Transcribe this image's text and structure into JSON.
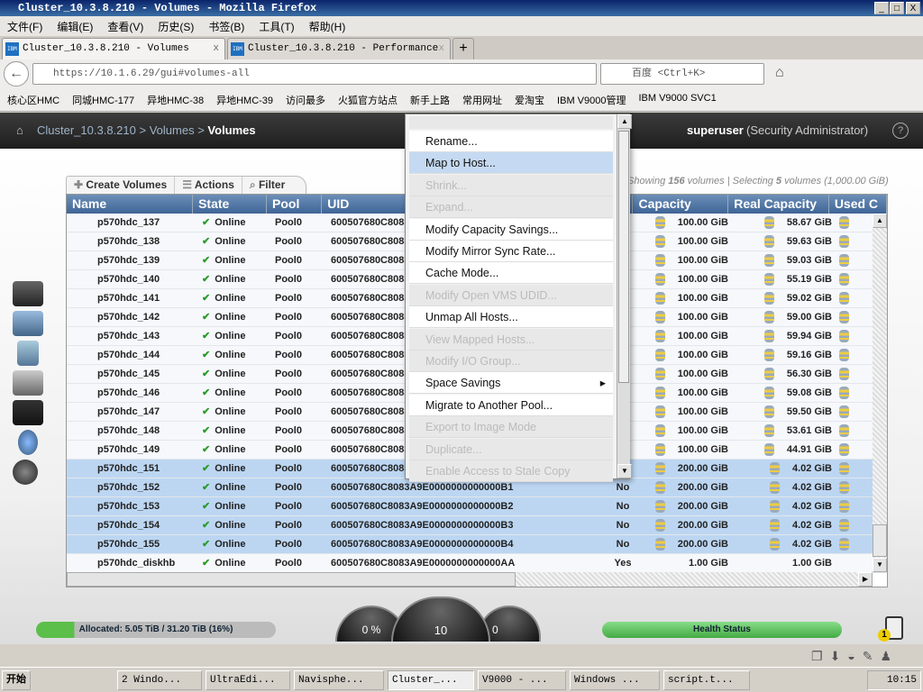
{
  "window": {
    "title": "Cluster_10.3.8.210 - Volumes - Mozilla Firefox",
    "min": "_",
    "max": "□",
    "close": "X"
  },
  "menubar": [
    "文件(F)",
    "编辑(E)",
    "查看(V)",
    "历史(S)",
    "书签(B)",
    "工具(T)",
    "帮助(H)"
  ],
  "tabs": [
    {
      "label": "Cluster_10.3.8.210 - Volumes",
      "close": "x"
    },
    {
      "label": "Cluster_10.3.8.210 - Performance",
      "close": "x"
    }
  ],
  "new_tab": "+",
  "url": "https://10.1.6.29/gui#volumes-all",
  "search_placeholder": "百度 <Ctrl+K>",
  "bookmarks": [
    "核心区HMC",
    "同城HMC-177",
    "异地HMC-38",
    "异地HMC-39",
    "访问最多",
    "火狐官方站点",
    "新手上路",
    "常用网址",
    "爱淘宝",
    "IBM V9000管理",
    "IBM V9000 SVC1"
  ],
  "app": {
    "breadcrumb": [
      "Cluster_10.3.8.210",
      "Volumes",
      "Volumes"
    ],
    "sep": ">",
    "user": "superuser",
    "role": "(Security Administrator)",
    "help": "?"
  },
  "toolbar": {
    "create": "Create Volumes",
    "actions": "Actions",
    "filter": "Filter"
  },
  "summary": {
    "prefix": "Showing ",
    "count": "156",
    "mid": " volumes | Selecting ",
    "sel": "5",
    "suffix": " volumes (1,000.00 GiB)"
  },
  "columns": [
    "Name",
    "State",
    "Pool",
    "UID",
    "",
    "Capacity",
    "Real Capacity",
    "Used C"
  ],
  "rows": [
    {
      "name": "p570hdc_137",
      "state": "Online",
      "pool": "Pool0",
      "uid": "600507680C8083",
      "flag": "",
      "cap": "100.00 GiB",
      "real": "58.67 GiB",
      "sel": false
    },
    {
      "name": "p570hdc_138",
      "state": "Online",
      "pool": "Pool0",
      "uid": "600507680C8083",
      "flag": "",
      "cap": "100.00 GiB",
      "real": "59.63 GiB",
      "sel": false
    },
    {
      "name": "p570hdc_139",
      "state": "Online",
      "pool": "Pool0",
      "uid": "600507680C8083",
      "flag": "",
      "cap": "100.00 GiB",
      "real": "59.03 GiB",
      "sel": false
    },
    {
      "name": "p570hdc_140",
      "state": "Online",
      "pool": "Pool0",
      "uid": "600507680C8083",
      "flag": "",
      "cap": "100.00 GiB",
      "real": "55.19 GiB",
      "sel": false
    },
    {
      "name": "p570hdc_141",
      "state": "Online",
      "pool": "Pool0",
      "uid": "600507680C8083",
      "flag": "",
      "cap": "100.00 GiB",
      "real": "59.02 GiB",
      "sel": false
    },
    {
      "name": "p570hdc_142",
      "state": "Online",
      "pool": "Pool0",
      "uid": "600507680C8083",
      "flag": "",
      "cap": "100.00 GiB",
      "real": "59.00 GiB",
      "sel": false
    },
    {
      "name": "p570hdc_143",
      "state": "Online",
      "pool": "Pool0",
      "uid": "600507680C8083",
      "flag": "",
      "cap": "100.00 GiB",
      "real": "59.94 GiB",
      "sel": false
    },
    {
      "name": "p570hdc_144",
      "state": "Online",
      "pool": "Pool0",
      "uid": "600507680C8083",
      "flag": "",
      "cap": "100.00 GiB",
      "real": "59.16 GiB",
      "sel": false
    },
    {
      "name": "p570hdc_145",
      "state": "Online",
      "pool": "Pool0",
      "uid": "600507680C8083",
      "flag": "",
      "cap": "100.00 GiB",
      "real": "56.30 GiB",
      "sel": false
    },
    {
      "name": "p570hdc_146",
      "state": "Online",
      "pool": "Pool0",
      "uid": "600507680C8083",
      "flag": "",
      "cap": "100.00 GiB",
      "real": "59.08 GiB",
      "sel": false
    },
    {
      "name": "p570hdc_147",
      "state": "Online",
      "pool": "Pool0",
      "uid": "600507680C8083",
      "flag": "",
      "cap": "100.00 GiB",
      "real": "59.50 GiB",
      "sel": false
    },
    {
      "name": "p570hdc_148",
      "state": "Online",
      "pool": "Pool0",
      "uid": "600507680C8083",
      "flag": "",
      "cap": "100.00 GiB",
      "real": "53.61 GiB",
      "sel": false
    },
    {
      "name": "p570hdc_149",
      "state": "Online",
      "pool": "Pool0",
      "uid": "600507680C8083",
      "flag": "",
      "cap": "100.00 GiB",
      "real": "44.91 GiB",
      "sel": false
    },
    {
      "name": "p570hdc_151",
      "state": "Online",
      "pool": "Pool0",
      "uid": "600507680C8083",
      "flag": "",
      "cap": "200.00 GiB",
      "real": "4.02 GiB",
      "sel": true
    },
    {
      "name": "p570hdc_152",
      "state": "Online",
      "pool": "Pool0",
      "uid": "600507680C8083A9E0000000000000B1",
      "flag": "No",
      "cap": "200.00 GiB",
      "real": "4.02 GiB",
      "sel": true
    },
    {
      "name": "p570hdc_153",
      "state": "Online",
      "pool": "Pool0",
      "uid": "600507680C8083A9E0000000000000B2",
      "flag": "No",
      "cap": "200.00 GiB",
      "real": "4.02 GiB",
      "sel": true
    },
    {
      "name": "p570hdc_154",
      "state": "Online",
      "pool": "Pool0",
      "uid": "600507680C8083A9E0000000000000B3",
      "flag": "No",
      "cap": "200.00 GiB",
      "real": "4.02 GiB",
      "sel": true
    },
    {
      "name": "p570hdc_155",
      "state": "Online",
      "pool": "Pool0",
      "uid": "600507680C8083A9E0000000000000B4",
      "flag": "No",
      "cap": "200.00 GiB",
      "real": "4.02 GiB",
      "sel": true
    },
    {
      "name": "p570hdc_diskhb",
      "state": "Online",
      "pool": "Pool0",
      "uid": "600507680C8083A9E0000000000000AA",
      "flag": "Yes",
      "cap": "1.00 GiB",
      "real": "1.00 GiB",
      "sel": false,
      "nodisk": true
    }
  ],
  "context_menu": [
    {
      "label": "Rename...",
      "disabled": false
    },
    {
      "label": "Map to Host...",
      "disabled": false,
      "hover": true
    },
    {
      "label": "Shrink...",
      "disabled": true
    },
    {
      "label": "Expand...",
      "disabled": true
    },
    {
      "label": "Modify Capacity Savings...",
      "disabled": false
    },
    {
      "label": "Modify Mirror Sync Rate...",
      "disabled": false
    },
    {
      "label": "Cache Mode...",
      "disabled": false
    },
    {
      "label": "Modify Open VMS UDID...",
      "disabled": true
    },
    {
      "label": "Unmap All Hosts...",
      "disabled": false
    },
    {
      "label": "View Mapped Hosts...",
      "disabled": true
    },
    {
      "label": "Modify I/O Group...",
      "disabled": true
    },
    {
      "label": "Space Savings",
      "disabled": false,
      "submenu": true
    },
    {
      "label": "Migrate to Another Pool...",
      "disabled": false
    },
    {
      "label": "Export to Image Mode",
      "disabled": true
    },
    {
      "label": "Duplicate...",
      "disabled": true
    },
    {
      "label": "Enable Access to Stale Copy",
      "disabled": true
    }
  ],
  "footer": {
    "allocated": "Allocated: 5.05 TiB / 31.20 TiB (16%)",
    "allocated_percent": 16,
    "gauge_left": "0 %",
    "gauge_mid": "10",
    "gauge_right": "0",
    "health": "Health Status",
    "alerts": "1"
  },
  "taskbar": {
    "start": "开始",
    "items": [
      "2 Windo...",
      "UltraEdi...",
      "Navisphe...",
      "Cluster_...",
      "V9000 - ...",
      "Windows ...",
      "script.t..."
    ],
    "clock": "10:15"
  },
  "colors": {
    "header": "#3f6596",
    "selected": "#bcd6f2",
    "health": "#5cbf4a"
  }
}
